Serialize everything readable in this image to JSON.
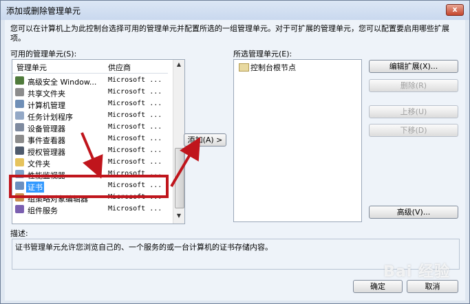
{
  "window": {
    "title": "添加或删除管理单元",
    "close_glyph": "x"
  },
  "intro": "您可以在计算机上为此控制台选择可用的管理单元并配置所选的一组管理单元。对于可扩展的管理单元，您可以配置要启用哪些扩展项。",
  "available": {
    "label": "可用的管理单元(S):",
    "col_name": "管理单元",
    "col_vendor": "供应商",
    "items": [
      {
        "name": "高级安全 Window...",
        "vendor": "Microsoft ...",
        "icon_color": "#4f7a3b"
      },
      {
        "name": "共享文件夹",
        "vendor": "Microsoft ...",
        "icon_color": "#8c8c8c"
      },
      {
        "name": "计算机管理",
        "vendor": "Microsoft ...",
        "icon_color": "#6f8fb7"
      },
      {
        "name": "任务计划程序",
        "vendor": "Microsoft ...",
        "icon_color": "#93a8c6"
      },
      {
        "name": "设备管理器",
        "vendor": "Microsoft ...",
        "icon_color": "#7e8a9f"
      },
      {
        "name": "事件查看器",
        "vendor": "Microsoft ...",
        "icon_color": "#8c8c8c"
      },
      {
        "name": "授权管理器",
        "vendor": "Microsoft ...",
        "icon_color": "#4f5b6d"
      },
      {
        "name": "文件夹",
        "vendor": "Microsoft ...",
        "icon_color": "#e6c35c"
      },
      {
        "name": "性能监视器",
        "vendor": "Microsoft ...",
        "icon_color": "#7ea1c9"
      },
      {
        "name": "证书",
        "vendor": "Microsoft ...",
        "icon_color": "#6b8fbf",
        "selected": true
      },
      {
        "name": "组策略对象编辑器",
        "vendor": "Microsoft ...",
        "icon_color": "#c98f4d"
      },
      {
        "name": "组件服务",
        "vendor": "Microsoft ...",
        "icon_color": "#7b5fb0"
      }
    ]
  },
  "add_button": "添加(A) >",
  "selected": {
    "label": "所选管理单元(E):",
    "root": "控制台根节点"
  },
  "buttons": {
    "edit_ext": "编辑扩展(X)...",
    "remove": "删除(R)",
    "move_up": "上移(U)",
    "move_down": "下移(D)",
    "advanced": "高级(V)...",
    "ok": "确定",
    "cancel": "取消"
  },
  "description": {
    "label": "描述:",
    "text": "证书管理单元允许您浏览自己的、一个服务的或一台计算机的证书存储内容。"
  },
  "watermark": "Bai 经验",
  "colors": {
    "selection": "#3399ff",
    "annotation": "#c0151c"
  }
}
